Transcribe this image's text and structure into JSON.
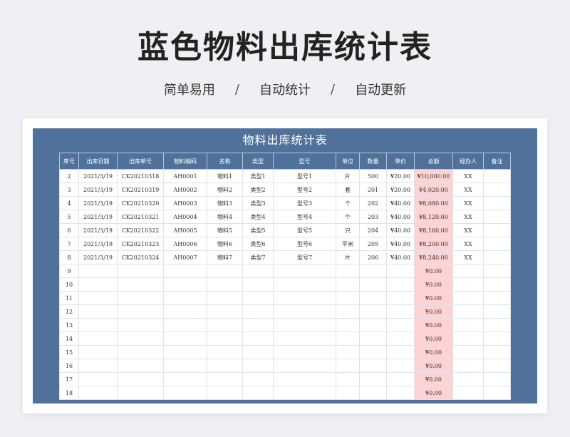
{
  "hero": {
    "title": "蓝色物料出库统计表",
    "tags": [
      "简单易用",
      "自动统计",
      "自动更新"
    ],
    "separator": "/"
  },
  "sheet": {
    "title": "物料出库统计表",
    "columns": [
      "序号",
      "出库日期",
      "出库单号",
      "物料编码",
      "名称",
      "类型",
      "型号",
      "单位",
      "数量",
      "单价",
      "总额",
      "经办人",
      "备注"
    ],
    "rows": [
      [
        "2",
        "2021/3/19",
        "CK20210318",
        "AH0001",
        "物料1",
        "类型1",
        "型号1",
        "片",
        "500",
        "¥20.00",
        "¥10,000.00",
        "XX",
        ""
      ],
      [
        "3",
        "2021/3/19",
        "CK20210319",
        "AH0002",
        "物料2",
        "类型2",
        "型号2",
        "套",
        "201",
        "¥20.00",
        "¥4,020.00",
        "XX",
        ""
      ],
      [
        "4",
        "2021/3/19",
        "CK20210320",
        "AH0003",
        "物料3",
        "类型3",
        "型号3",
        "个",
        "202",
        "¥40.00",
        "¥8,080.00",
        "XX",
        ""
      ],
      [
        "5",
        "2021/3/19",
        "CK20210321",
        "AH0004",
        "物料4",
        "类型4",
        "型号4",
        "个",
        "203",
        "¥40.00",
        "¥8,120.00",
        "XX",
        ""
      ],
      [
        "6",
        "2021/3/19",
        "CK20210322",
        "AH0005",
        "物料5",
        "类型5",
        "型号5",
        "只",
        "204",
        "¥40.00",
        "¥8,160.00",
        "XX",
        ""
      ],
      [
        "7",
        "2021/3/19",
        "CK20210323",
        "AH0006",
        "物料6",
        "类型6",
        "型号6",
        "平米",
        "205",
        "¥40.00",
        "¥8,200.00",
        "XX",
        ""
      ],
      [
        "8",
        "2021/3/19",
        "CK20210324",
        "AH0007",
        "物料7",
        "类型7",
        "型号7",
        "片",
        "206",
        "¥40.00",
        "¥8,240.00",
        "XX",
        ""
      ],
      [
        "9",
        "",
        "",
        "",
        "",
        "",
        "",
        "",
        "",
        "",
        "¥0.00",
        "",
        ""
      ],
      [
        "10",
        "",
        "",
        "",
        "",
        "",
        "",
        "",
        "",
        "",
        "¥0.00",
        "",
        ""
      ],
      [
        "11",
        "",
        "",
        "",
        "",
        "",
        "",
        "",
        "",
        "",
        "¥0.00",
        "",
        ""
      ],
      [
        "12",
        "",
        "",
        "",
        "",
        "",
        "",
        "",
        "",
        "",
        "¥0.00",
        "",
        ""
      ],
      [
        "13",
        "",
        "",
        "",
        "",
        "",
        "",
        "",
        "",
        "",
        "¥0.00",
        "",
        ""
      ],
      [
        "14",
        "",
        "",
        "",
        "",
        "",
        "",
        "",
        "",
        "",
        "¥0.00",
        "",
        ""
      ],
      [
        "15",
        "",
        "",
        "",
        "",
        "",
        "",
        "",
        "",
        "",
        "¥0.00",
        "",
        ""
      ],
      [
        "16",
        "",
        "",
        "",
        "",
        "",
        "",
        "",
        "",
        "",
        "¥0.00",
        "",
        ""
      ],
      [
        "17",
        "",
        "",
        "",
        "",
        "",
        "",
        "",
        "",
        "",
        "¥0.00",
        "",
        ""
      ],
      [
        "18",
        "",
        "",
        "",
        "",
        "",
        "",
        "",
        "",
        "",
        "¥0.00",
        "",
        ""
      ]
    ]
  },
  "colors": {
    "sheet_bg": "#50729a",
    "total_highlight": "#ffd3d3",
    "page_bg": "#eef0f3"
  }
}
